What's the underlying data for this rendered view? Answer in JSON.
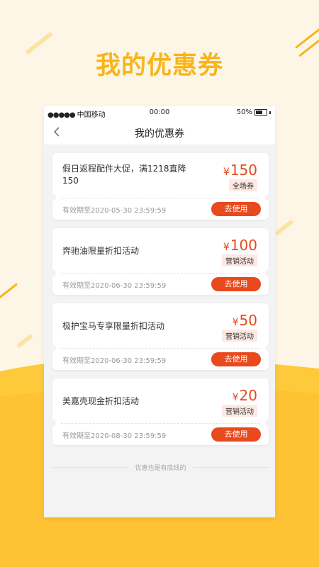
{
  "promo": {
    "title": "我的优惠券"
  },
  "statusbar": {
    "signal": "●●●●●",
    "carrier": "中国移动",
    "time": "00:00",
    "battery": "50%"
  },
  "navbar": {
    "title": "我的优惠券"
  },
  "coupons": [
    {
      "title": "假日返程配件大促，满1218直降150",
      "currency": "¥",
      "amount": "150",
      "tag": "全场券",
      "validity": "有效期至2020-05-30  23:59:59",
      "button": "去使用"
    },
    {
      "title": "奔驰油限量折扣活动",
      "currency": "¥",
      "amount": "100",
      "tag": "营销活动",
      "validity": "有效期至2020-06-30  23:59:59",
      "button": "去使用"
    },
    {
      "title": "极护宝马专享限量折扣活动",
      "currency": "¥",
      "amount": "50",
      "tag": "营销活动",
      "validity": "有效期至2020-06-30  23:59:59",
      "button": "去使用"
    },
    {
      "title": "美嘉壳现金折扣活动",
      "currency": "¥",
      "amount": "20",
      "tag": "营销活动",
      "validity": "有效期至2020-08-30  23:59:59",
      "button": "去使用"
    }
  ],
  "footer": {
    "text": "优惠也是有底线的"
  },
  "colors": {
    "brand_yellow": "#f7b51c",
    "accent_orange": "#e8491d",
    "background": "#fdf6e6"
  }
}
